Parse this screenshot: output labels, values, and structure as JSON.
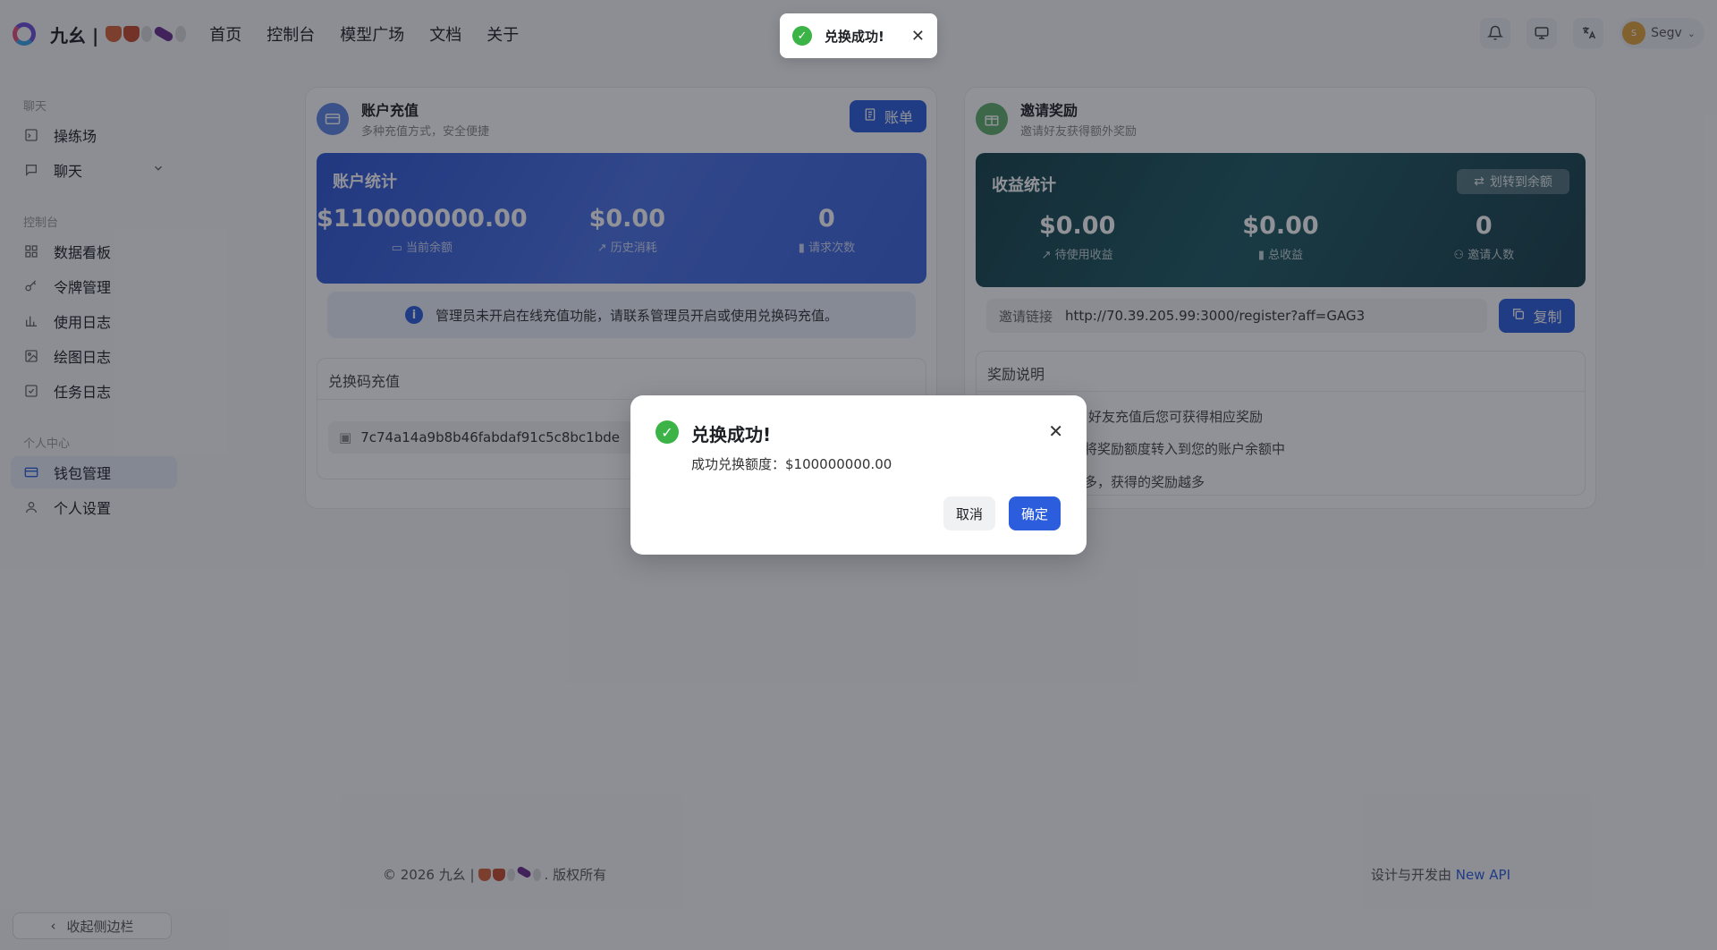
{
  "header": {
    "brand": "九幺 |",
    "nav": [
      "首页",
      "控制台",
      "模型广场",
      "文档",
      "关于"
    ],
    "user_name": "Segv",
    "avatar_letter": "S"
  },
  "sidebar": {
    "groups": {
      "chat": "聊天",
      "console": "控制台",
      "personal": "个人中心"
    },
    "items": {
      "playground": "操练场",
      "chat": "聊天",
      "dashboard": "数据看板",
      "tokens": "令牌管理",
      "usage_log": "使用日志",
      "drawing_log": "绘图日志",
      "task_log": "任务日志",
      "wallet": "钱包管理",
      "settings": "个人设置"
    },
    "collapse_label": "收起侧边栏"
  },
  "recharge": {
    "title": "账户充值",
    "subtitle": "多种充值方式，安全便捷",
    "bill_button": "账单",
    "stats_title": "账户统计",
    "balance_value": "$110000000.00",
    "balance_label": "当前余额",
    "spent_value": "$0.00",
    "spent_label": "历史消耗",
    "requests_value": "0",
    "requests_label": "请求次数",
    "notice": "管理员未开启在线充值功能，请联系管理员开启或使用兑换码充值。",
    "redeem_title": "兑换码充值",
    "redeem_code": "7c74a14a9b8b46fabdaf91c5c8bc1bde"
  },
  "invite": {
    "title": "邀请奖励",
    "subtitle": "邀请好友获得额外奖励",
    "stats_title": "收益统计",
    "transfer_button": "划转到余额",
    "pending_value": "$0.00",
    "pending_label": "待使用收益",
    "total_value": "$0.00",
    "total_label": "总收益",
    "invited_value": "0",
    "invited_label": "邀请人数",
    "link_label": "邀请链接",
    "link_value": "http://70.39.205.99:3000/register?aff=GAG3",
    "copy_button": "复制",
    "rules_title": "奖励说明",
    "rules": [
      "，好友充值后您可获得相应奖励",
      "将奖励额度转入到您的账户余额中",
      "多，获得的奖励越多"
    ]
  },
  "footer": {
    "copyright_prefix": "© 2026 九幺 |",
    "copyright_suffix": ". 版权所有",
    "made_by": "设计与开发由",
    "made_by_link": "New API"
  },
  "modal": {
    "title": "兑换成功!",
    "body": "成功兑换额度：$100000000.00",
    "cancel": "取消",
    "ok": "确定"
  },
  "toast": {
    "text": "兑换成功!"
  },
  "colors": {
    "primary": "#2b5ddc",
    "success": "#3bb346",
    "link": "#2b5ddc"
  }
}
